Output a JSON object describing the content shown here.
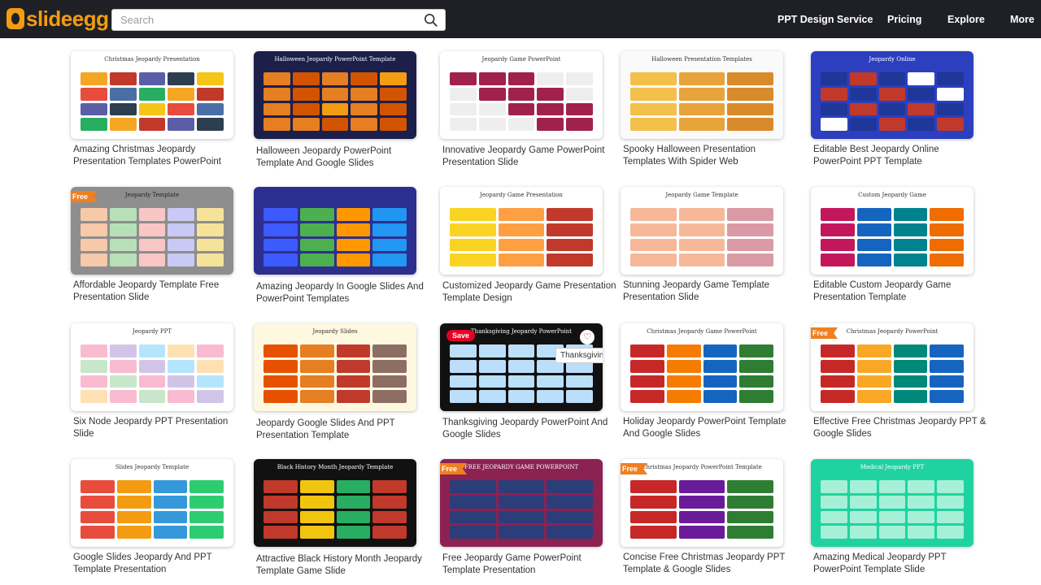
{
  "header": {
    "logo_text": "slideegg",
    "search_placeholder": "Search",
    "nav": [
      "PPT Design Service",
      "Pricing",
      "Explore",
      "More"
    ]
  },
  "badges": {
    "free": "Free",
    "save": "Save",
    "tooltip": "Thanksgiving"
  },
  "cards": [
    {
      "caption": "Amazing Christmas Jeopardy Presentation Templates PowerPoint",
      "thumb_title": "Christmas Jeopardy Presentation"
    },
    {
      "caption": "Halloween Jeopardy PowerPoint Template And Google Slides",
      "thumb_title": "Halloween Jeopardy PowerPoint Template"
    },
    {
      "caption": "Innovative Jeopardy Game PowerPoint Presentation Slide",
      "thumb_title": "Jeopardy Game PowerPoint"
    },
    {
      "caption": "Spooky Halloween Presentation Templates With Spider Web",
      "thumb_title": "Halloween Presentation Templates"
    },
    {
      "caption": "Editable Best Jeopardy Online PowerPoint PPT Template",
      "thumb_title": "Jeopardy Online"
    },
    {
      "caption": "Affordable Jeopardy Template Free Presentation Slide",
      "thumb_title": "Jeopardy Template"
    },
    {
      "caption": "Amazing Jeopardy In Google Slides And PowerPoint Templates",
      "thumb_title": ""
    },
    {
      "caption": "Customized Jeopardy Game Presentation Template Design",
      "thumb_title": "Jeopardy Game Presentation"
    },
    {
      "caption": "Stunning Jeopardy Game Template Presentation Slide",
      "thumb_title": "Jeopardy Game Template"
    },
    {
      "caption": "Editable Custom Jeopardy Game Presentation Template",
      "thumb_title": "Custom Jeopardy Game"
    },
    {
      "caption": "Six Node Jeopardy PPT Presentation Slide",
      "thumb_title": "Jeopardy PPT"
    },
    {
      "caption": "Jeopardy Google Slides And PPT Presentation Template",
      "thumb_title": "Jeopardy Slides"
    },
    {
      "caption": "Thanksgiving Jeopardy PowerPoint And Google Slides",
      "thumb_title": "Thanksgiving Jeopardy PowerPoint"
    },
    {
      "caption": "Holiday Jeopardy PowerPoint Template And Google Slides",
      "thumb_title": "Christmas Jeopardy Game PowerPoint"
    },
    {
      "caption": "Effective Free Christmas Jeopardy PPT & Google Slides",
      "thumb_title": "Christmas Jeopardy PowerPoint"
    },
    {
      "caption": "Google Slides Jeopardy And PPT Template Presentation",
      "thumb_title": "Slides Jeopardy Template"
    },
    {
      "caption": "Attractive Black History Month Jeopardy Template Game Slide",
      "thumb_title": "Black History Month Jeopardy Template"
    },
    {
      "caption": "Free Jeopardy Game PowerPoint Template Presentation",
      "thumb_title": "FREE JEOPARDY GAME POWERPOINT"
    },
    {
      "caption": "Concise Free Christmas Jeopardy PPT Template & Google Slides",
      "thumb_title": "Christmas Jeopardy PowerPoint Template"
    },
    {
      "caption": "Amazing Medical Jeopardy PPT PowerPoint Template Slide",
      "thumb_title": "Medical Jeopardy PPT"
    }
  ],
  "colors": {
    "header_bg": "#1f2026",
    "brand_orange": "#f39c12",
    "free_badge": "#f07f1f",
    "pinterest_red": "#e60023"
  }
}
